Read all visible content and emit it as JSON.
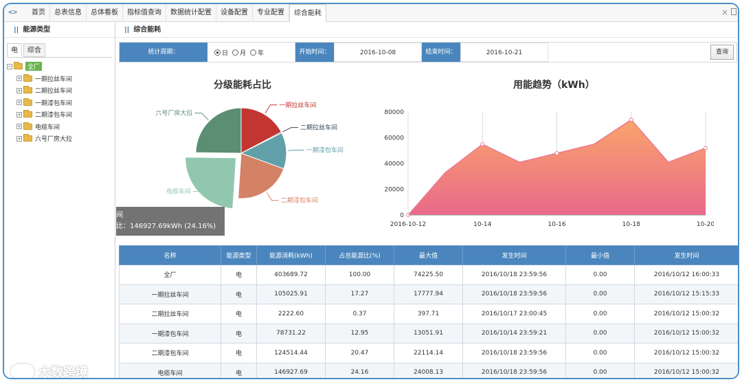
{
  "nav": {
    "tabs": [
      "首页",
      "总表信息",
      "总体看板",
      "指标值查询",
      "数据统计配置",
      "设备配置",
      "专业配置",
      "综合能耗"
    ],
    "active_tab": "综合能耗"
  },
  "left_panel": {
    "title": "能源类型",
    "tabs": [
      "电",
      "综合"
    ],
    "tree": {
      "root": "全厂",
      "children": [
        "一期拉丝车间",
        "二期拉丝车间",
        "一期漆包车间",
        "二期漆包车间",
        "电缆车间",
        "六号厂房大拉"
      ]
    }
  },
  "main": {
    "title": "综合能耗",
    "filter": {
      "period_label": "统计周期：",
      "options": [
        "日",
        "月",
        "年"
      ],
      "selected": "日",
      "start_label": "开始时间：",
      "start_value": "2016-10-08",
      "end_label": "结束时间：",
      "end_value": "2016-10-21",
      "query_label": "查询"
    },
    "tooltip": {
      "line1": "间",
      "line2": "比：146927.69kWh (24.16%)"
    },
    "table": {
      "headers": [
        "名称",
        "能源类型",
        "能源消耗(kWh)",
        "占总能源比(%)",
        "最大值",
        "发生时间",
        "最小值",
        "发生时间"
      ],
      "rows": [
        [
          "全厂",
          "电",
          "403689.72",
          "100.00",
          "74225.50",
          "2016/10/18 23:59:56",
          "0.00",
          "2016/10/12 16:00:33"
        ],
        [
          "一期拉丝车间",
          "电",
          "105025.91",
          "17.27",
          "17777.94",
          "2016/10/18 23:59:56",
          "0.00",
          "2016/10/12 15:15:33"
        ],
        [
          "二期拉丝车间",
          "电",
          "2222.60",
          "0.37",
          "397.71",
          "2016/10/17 23:00:45",
          "0.00",
          "2016/10/12 15:00:32"
        ],
        [
          "一期漆包车间",
          "电",
          "78731.22",
          "12.95",
          "13051.91",
          "2016/10/14 23:59:21",
          "0.00",
          "2016/10/12 15:00:32"
        ],
        [
          "二期漆包车间",
          "电",
          "124514.44",
          "20.47",
          "22114.14",
          "2016/10/18 23:59:56",
          "0.00",
          "2016/10/12 15:00:32"
        ],
        [
          "电缆车间",
          "电",
          "146927.69",
          "24.16",
          "24008.13",
          "2016/10/18 23:59:56",
          "0.00",
          "2016/10/12 15:00:32"
        ]
      ]
    }
  },
  "watermark": "大数跨境",
  "chart_data": [
    {
      "type": "pie",
      "title": "分级能耗占比",
      "labels": [
        "一期拉丝车间",
        "二期拉丝车间",
        "一期漆包车间",
        "二期漆包车间",
        "电缆车间",
        "六号厂房大拉"
      ],
      "values": [
        17.27,
        0.37,
        12.95,
        20.47,
        24.16,
        24.78
      ],
      "colors": [
        "#c23531",
        "#2f4554",
        "#61a0a8",
        "#d48265",
        "#91c7ae",
        "#5b8e73"
      ],
      "highlighted": "电缆车间"
    },
    {
      "type": "area",
      "title": "用能趋势（kWh）",
      "x": [
        "2016-10-12",
        "2016-10-13",
        "2016-10-14",
        "2016-10-15",
        "2016-10-16",
        "2016-10-17",
        "2016-10-18",
        "2016-10-19",
        "2016-10-20"
      ],
      "x_tick_labels": [
        "2016-10-12",
        "10-14",
        "10-16",
        "10-18",
        "10-20"
      ],
      "values": [
        0,
        33000,
        55000,
        41000,
        48000,
        55000,
        74000,
        41000,
        52000
      ],
      "ylim": [
        0,
        80000
      ],
      "yticks": [
        0,
        20000,
        40000,
        60000,
        80000
      ]
    }
  ]
}
